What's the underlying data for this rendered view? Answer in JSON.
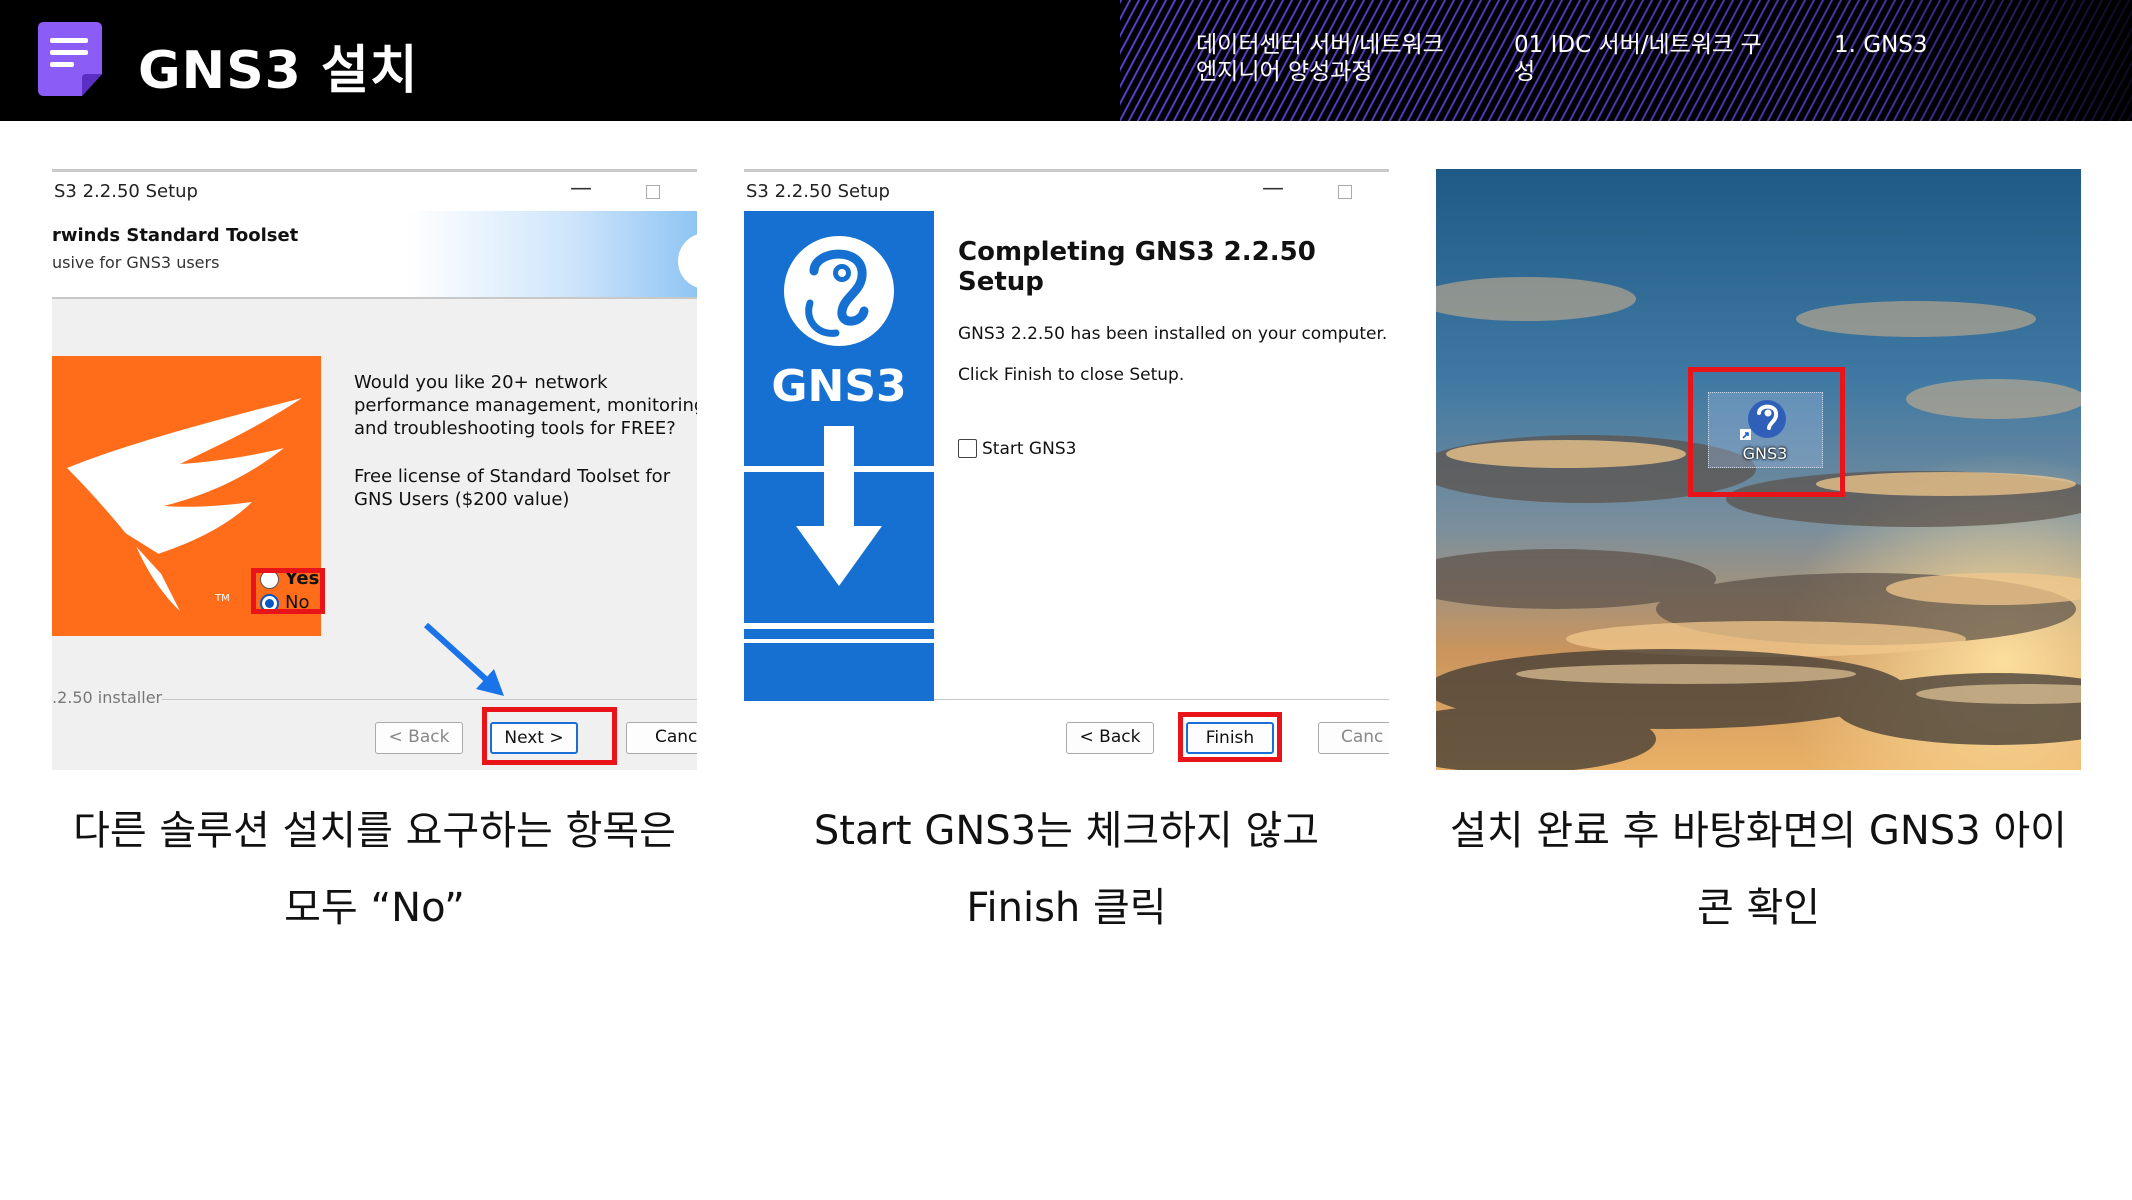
{
  "header": {
    "title": "GNS3 설치",
    "breadcrumbs": [
      "데이터센터 서버/네트워크 엔지니어 양성과정",
      "01 IDC 서버/네트워크 구성",
      "1. GNS3"
    ]
  },
  "panel1": {
    "window_title": "S3 2.2.50 Setup",
    "banner_heading": "rwinds Standard Toolset",
    "banner_subheading": "usive for GNS3 users",
    "question": "Would you like 20+ network performance management, monitoring, and troubleshooting tools for FREE?",
    "license": "Free license of Standard Toolset for GNS Users ($200 value)",
    "option_yes": "Yes",
    "option_no": "No",
    "selected_option": "No",
    "footer": ".2.50 installer",
    "buttons": {
      "back": "< Back",
      "next": "Next >",
      "cancel": "Canc"
    },
    "logo_mark": "TM"
  },
  "panel2": {
    "window_title": "S3 2.2.50 Setup",
    "brand": "GNS3",
    "heading": "Completing GNS3 2.2.50 Setup",
    "installed_text": "GNS3 2.2.50 has been installed on your computer.",
    "finish_text": "Click Finish to close Setup.",
    "checkbox_label": "Start GNS3",
    "checkbox_checked": false,
    "buttons": {
      "back": "< Back",
      "finish": "Finish",
      "cancel": "Canc"
    }
  },
  "panel3": {
    "desktop_icon_label": "GNS3"
  },
  "captions": {
    "cap1_line1": "다른 솔루션 설치를 요구하는 항목은",
    "cap1_line2": "모두 “No”",
    "cap2_line1": "Start GNS3는 체크하지 않고",
    "cap2_line2": "Finish 클릭",
    "cap3_line1": "설치 완료 후 바탕화면의 GNS3 아이",
    "cap3_line2": "콘 확인"
  },
  "colors": {
    "header_bg": "#000000",
    "accent_purple": "#8b5cf6",
    "highlight_red": "#e8141a",
    "solarwinds_orange": "#ff6d1a",
    "gns3_blue": "#1670d2",
    "arrow_blue": "#1a73e8"
  }
}
